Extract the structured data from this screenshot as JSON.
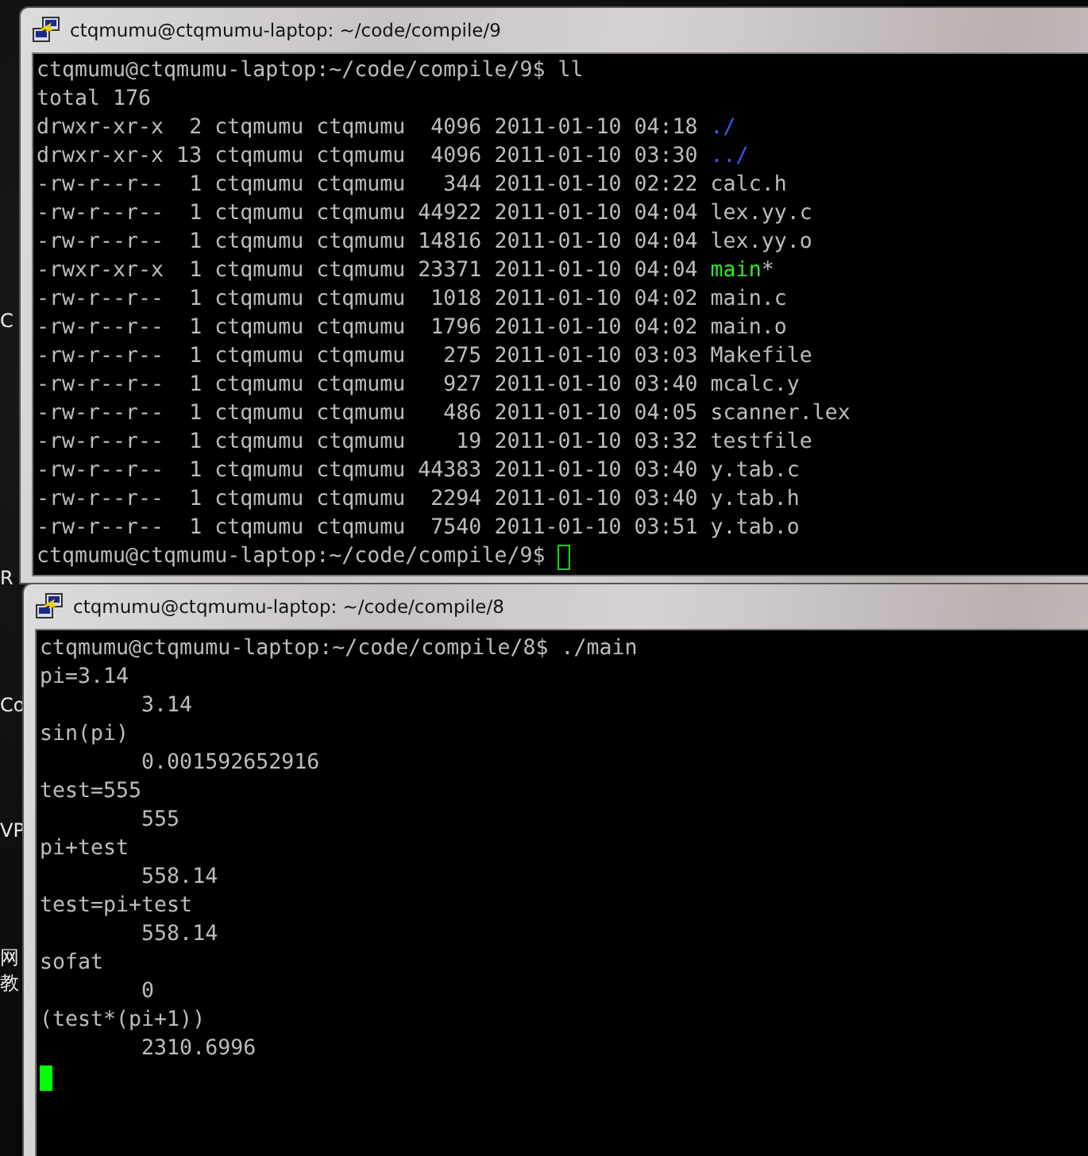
{
  "desktop_labels": [
    {
      "text": "C"
    },
    {
      "text": "R"
    },
    {
      "text": "Co"
    },
    {
      "text": "VP"
    },
    {
      "text": "网"
    },
    {
      "text": "教"
    }
  ],
  "terminals": [
    {
      "title": "ctqmumu@ctqmumu-laptop: ~/code/compile/9",
      "focused": false,
      "lines": [
        {
          "text": "ctqmumu@ctqmumu-laptop:~/code/compile/9$ ll"
        },
        {
          "text": "total 176"
        },
        {
          "text": "drwxr-xr-x  2 ctqmumu ctqmumu  4096 2011-01-10 04:18 ",
          "file": "./",
          "kind": "dir"
        },
        {
          "text": "drwxr-xr-x 13 ctqmumu ctqmumu  4096 2011-01-10 03:30 ",
          "file": "../",
          "kind": "dir"
        },
        {
          "text": "-rw-r--r--  1 ctqmumu ctqmumu   344 2011-01-10 02:22 ",
          "file": "calc.h",
          "kind": "file"
        },
        {
          "text": "-rw-r--r--  1 ctqmumu ctqmumu 44922 2011-01-10 04:04 ",
          "file": "lex.yy.c",
          "kind": "file"
        },
        {
          "text": "-rw-r--r--  1 ctqmumu ctqmumu 14816 2011-01-10 04:04 ",
          "file": "lex.yy.o",
          "kind": "file"
        },
        {
          "text": "-rwxr-xr-x  1 ctqmumu ctqmumu 23371 2011-01-10 04:04 ",
          "file": "main",
          "kind": "exec",
          "suffix": "*"
        },
        {
          "text": "-rw-r--r--  1 ctqmumu ctqmumu  1018 2011-01-10 04:02 ",
          "file": "main.c",
          "kind": "file"
        },
        {
          "text": "-rw-r--r--  1 ctqmumu ctqmumu  1796 2011-01-10 04:02 ",
          "file": "main.o",
          "kind": "file"
        },
        {
          "text": "-rw-r--r--  1 ctqmumu ctqmumu   275 2011-01-10 03:03 ",
          "file": "Makefile",
          "kind": "file"
        },
        {
          "text": "-rw-r--r--  1 ctqmumu ctqmumu   927 2011-01-10 03:40 ",
          "file": "mcalc.y",
          "kind": "file"
        },
        {
          "text": "-rw-r--r--  1 ctqmumu ctqmumu   486 2011-01-10 04:05 ",
          "file": "scanner.lex",
          "kind": "file"
        },
        {
          "text": "-rw-r--r--  1 ctqmumu ctqmumu    19 2011-01-10 03:32 ",
          "file": "testfile",
          "kind": "file"
        },
        {
          "text": "-rw-r--r--  1 ctqmumu ctqmumu 44383 2011-01-10 03:40 ",
          "file": "y.tab.c",
          "kind": "file"
        },
        {
          "text": "-rw-r--r--  1 ctqmumu ctqmumu  2294 2011-01-10 03:40 ",
          "file": "y.tab.h",
          "kind": "file"
        },
        {
          "text": "-rw-r--r--  1 ctqmumu ctqmumu  7540 2011-01-10 03:51 ",
          "file": "y.tab.o",
          "kind": "file"
        },
        {
          "text": "ctqmumu@ctqmumu-laptop:~/code/compile/9$ ",
          "cursor": true
        }
      ]
    },
    {
      "title": "ctqmumu@ctqmumu-laptop: ~/code/compile/8",
      "focused": true,
      "lines": [
        {
          "text": "ctqmumu@ctqmumu-laptop:~/code/compile/8$ ./main"
        },
        {
          "text": "pi=3.14"
        },
        {
          "text": "        3.14"
        },
        {
          "text": "sin(pi)"
        },
        {
          "text": "        0.001592652916"
        },
        {
          "text": "test=555"
        },
        {
          "text": "        555"
        },
        {
          "text": "pi+test"
        },
        {
          "text": "        558.14"
        },
        {
          "text": "test=pi+test"
        },
        {
          "text": "        558.14"
        },
        {
          "text": "sofat"
        },
        {
          "text": "        0"
        },
        {
          "text": "(test*(pi+1))"
        },
        {
          "text": "        2310.6996"
        },
        {
          "cursor": true
        }
      ]
    }
  ]
}
